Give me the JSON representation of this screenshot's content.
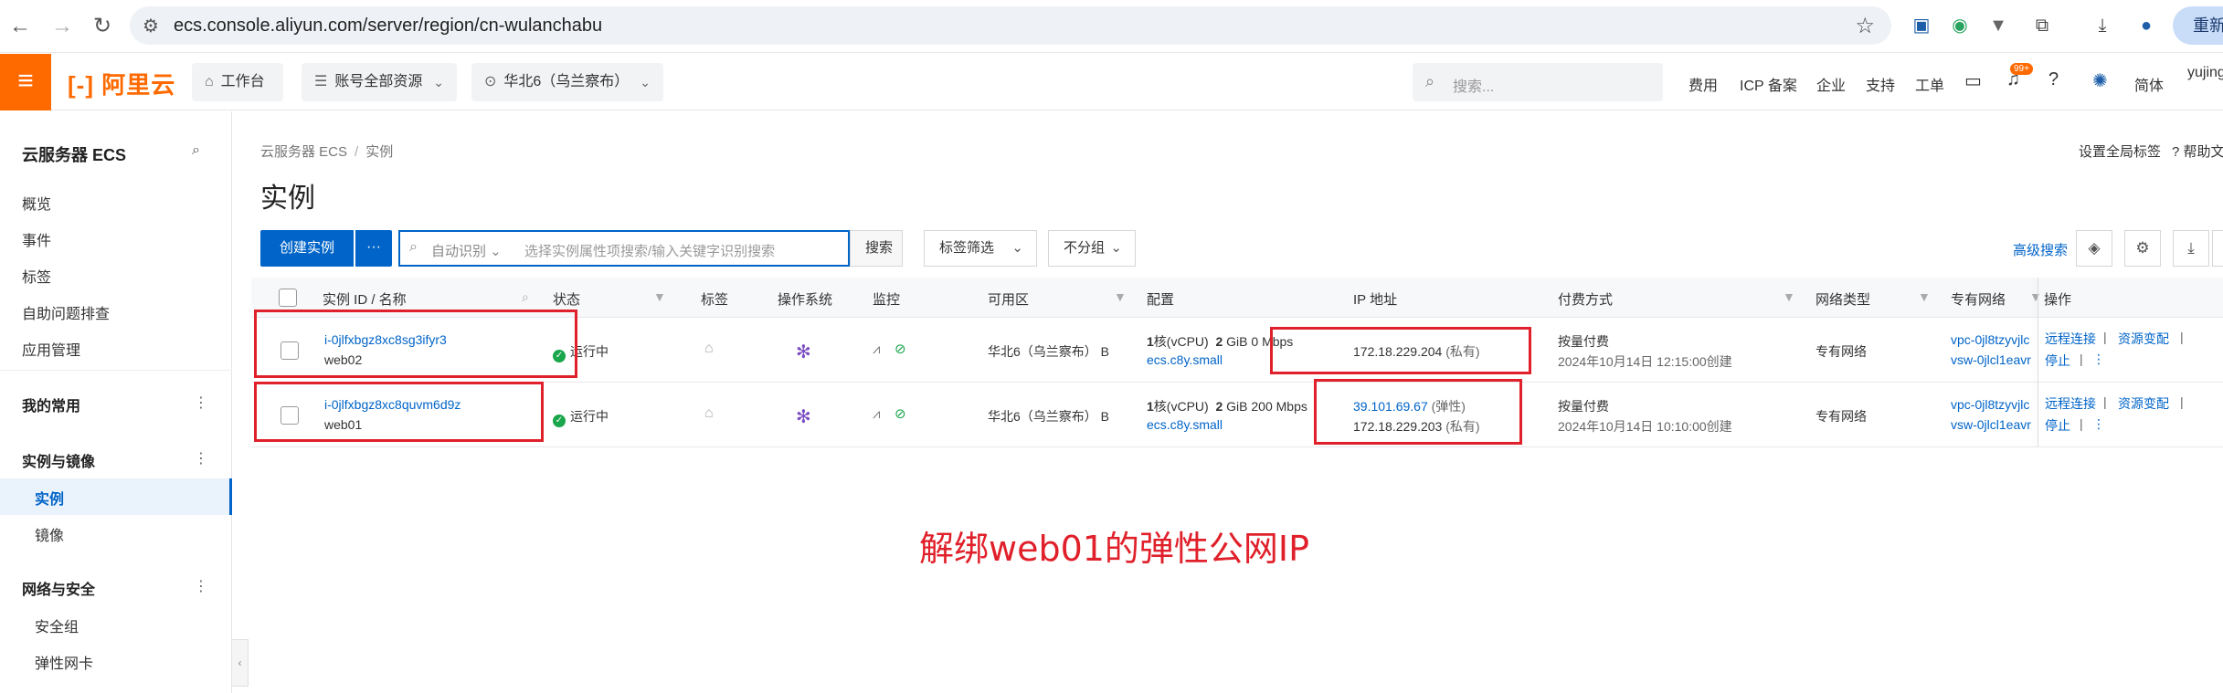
{
  "browser": {
    "url": "ecs.console.aliyun.com/server/region/cn-wulanchabu",
    "relaunch_label": "重新启"
  },
  "topnav": {
    "logo": "阿里云",
    "workbench": "工作台",
    "resource_scope": "账号全部资源",
    "region": "华北6（乌兰察布）",
    "search_placeholder": "搜索...",
    "links": [
      "费用",
      "ICP 备案",
      "企业",
      "支持",
      "工单"
    ],
    "notification_badge": "99+",
    "language": "简体",
    "user": "yujing"
  },
  "sidebar": {
    "title": "云服务器 ECS",
    "items": [
      "概览",
      "事件",
      "标签",
      "自助问题排查",
      "应用管理"
    ],
    "group_favorites": "我的常用",
    "group_instances": "实例与镜像",
    "instances_sub": [
      "实例",
      "镜像"
    ],
    "group_network": "网络与安全",
    "network_sub": [
      "安全组",
      "弹性网卡"
    ]
  },
  "main": {
    "breadcrumb": [
      "云服务器 ECS",
      "实例"
    ],
    "title": "实例",
    "set_tags": "设置全局标签",
    "help": "帮助文",
    "create_button": "创建实例",
    "more_button": "···",
    "search_select": "自动识别",
    "search_placeholder": "选择实例属性项搜索/输入关键字识别搜索",
    "search_button": "搜索",
    "tag_filter": "标签筛选",
    "group": "不分组",
    "advanced_search": "高级搜索"
  },
  "table": {
    "headers": {
      "id": "实例 ID / 名称",
      "status": "状态",
      "tags": "标签",
      "os": "操作系统",
      "monitor": "监控",
      "zone": "可用区",
      "config": "配置",
      "ip": "IP 地址",
      "billing": "付费方式",
      "network": "网络类型",
      "vpc": "专有网络",
      "ops": "操作"
    },
    "rows": [
      {
        "id": "i-0jlfxbgz8xc8sg3ifyr3",
        "name": "web02",
        "status": "运行中",
        "zone": "华北6（乌兰察布） B",
        "cpu_num": "1",
        "cpu_unit": "核(vCPU)",
        "mem_num": "2",
        "mem_unit": "GiB",
        "bandwidth": "0 Mbps",
        "spec": "ecs.c8y.small",
        "ip1": "172.18.229.204",
        "ip1_tag": "(私有)",
        "ip2": "",
        "ip2_tag": "",
        "billing": "按量付费",
        "created": "2024年10月14日 12:15:00创建",
        "network": "专有网络",
        "vpc": "vpc-0jl8tzyvjlc",
        "vsw": "vsw-0jlcl1eavr",
        "op_connect": "远程连接",
        "op_resource": "资源变配",
        "op_stop": "停止"
      },
      {
        "id": "i-0jlfxbgz8xc8quvm6d9z",
        "name": "web01",
        "status": "运行中",
        "zone": "华北6（乌兰察布） B",
        "cpu_num": "1",
        "cpu_unit": "核(vCPU)",
        "mem_num": "2",
        "mem_unit": "GiB",
        "bandwidth": "200 Mbps",
        "spec": "ecs.c8y.small",
        "ip1": "39.101.69.67",
        "ip1_tag": "(弹性)",
        "ip2": "172.18.229.203",
        "ip2_tag": "(私有)",
        "billing": "按量付费",
        "created": "2024年10月14日 10:10:00创建",
        "network": "专有网络",
        "vpc": "vpc-0jl8tzyvjlc",
        "vsw": "vsw-0jlcl1eavr",
        "op_connect": "远程连接",
        "op_resource": "资源变配",
        "op_stop": "停止"
      }
    ]
  },
  "annotation": "解绑web01的弹性公网IP",
  "colors": {
    "brand": "#ff6a00",
    "primary": "#0064c8",
    "annotation_red": "#e0202a",
    "running": "#1aa64a"
  }
}
